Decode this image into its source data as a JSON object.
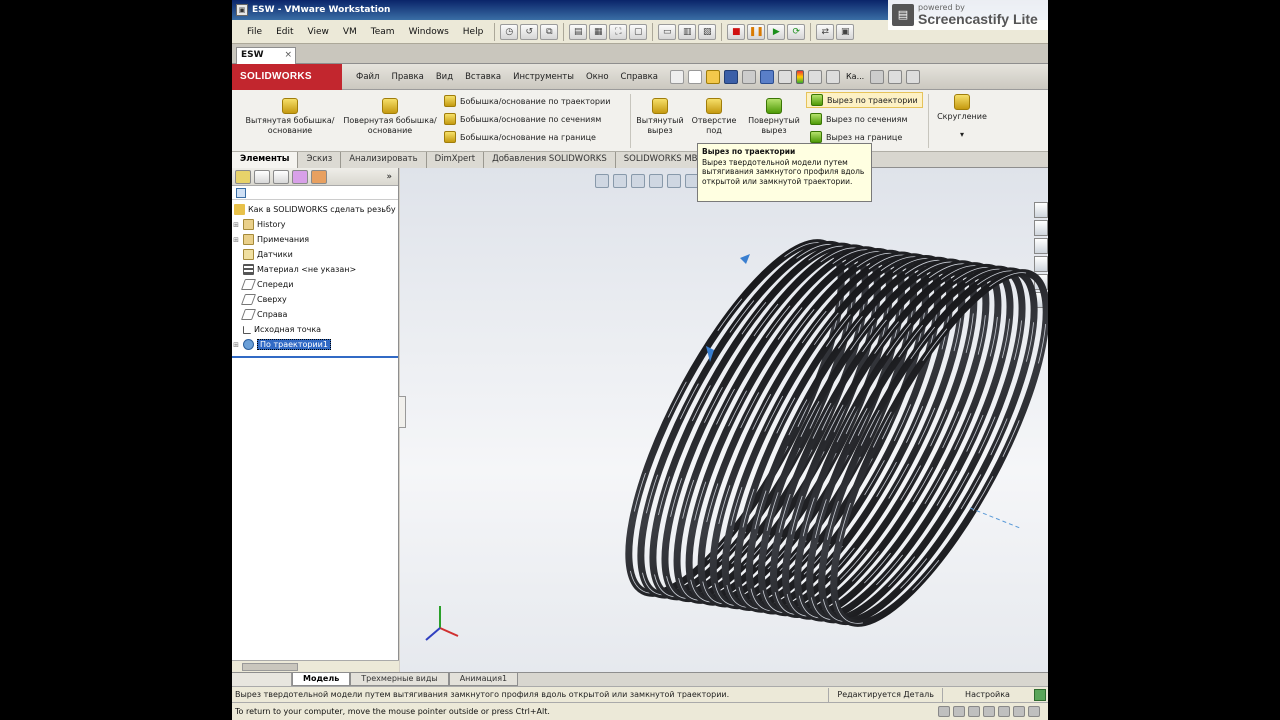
{
  "vm": {
    "window_title": "ESW - VMware Workstation",
    "menu": [
      "File",
      "Edit",
      "View",
      "VM",
      "Team",
      "Windows",
      "Help"
    ],
    "tab_label": "ESW",
    "tab_close": "×",
    "hint": "To return to your computer, move the mouse pointer outside or press Ctrl+Alt."
  },
  "watermark": {
    "small": "powered by",
    "big": "Screencastify Lite"
  },
  "solidworks": {
    "logo": "SOLIDWORKS",
    "menu": [
      "Файл",
      "Правка",
      "Вид",
      "Вставка",
      "Инструменты",
      "Окно",
      "Справка"
    ],
    "search_short": "Ка..."
  },
  "ribbon": {
    "extruded_boss": "Вытянутая бобышка/основание",
    "revolved_boss": "Повернутая бобышка/основание",
    "swept_boss": "Бобышка/основание по траектории",
    "lofted_boss": "Бобышка/основание по сечениям",
    "boundary_boss": "Бобышка/основание на границе",
    "extruded_cut": "Вытянутый вырез",
    "hole_wizard": "Отверстие под",
    "revolved_cut": "Повернутый вырез",
    "swept_cut": "Вырез по траектории",
    "lofted_cut": "Вырез по сечениям",
    "boundary_cut": "Вырез на границе",
    "fillet": "Скругление"
  },
  "cm_tabs": [
    "Элементы",
    "Эскиз",
    "Анализировать",
    "DimXpert",
    "Добавления SOLIDWORKS",
    "SOLIDWORKS MBD"
  ],
  "tooltip": {
    "title": "Вырез по траектории",
    "body": "Вырез твердотельной модели путем вытягивания замкнутого профиля вдоль открытой или замкнутой траектории."
  },
  "tree": {
    "root": "Как в SOLIDWORKS сделать резьбу",
    "items": [
      {
        "label": "History",
        "expandable": true
      },
      {
        "label": "Примечания",
        "expandable": true
      },
      {
        "label": "Датчики",
        "expandable": false
      },
      {
        "label": "Материал <не указан>",
        "expandable": false
      },
      {
        "label": "Спереди",
        "expandable": false
      },
      {
        "label": "Сверху",
        "expandable": false
      },
      {
        "label": "Справа",
        "expandable": false
      },
      {
        "label": "Исходная точка",
        "expandable": false
      },
      {
        "label": "По траектории1",
        "expandable": true,
        "selected": true
      }
    ]
  },
  "model_tabs": [
    "Модель",
    "Трехмерные виды",
    "Анимация1"
  ],
  "status": {
    "message": "Вырез твердотельной модели путем вытягивания замкнутого профиля вдоль открытой или замкнутой траектории.",
    "editing": "Редактируется Деталь",
    "settings": "Настройка"
  },
  "colors": {
    "vm_title": "#0a246a",
    "sw_red": "#c2262e",
    "selection": "#316ac5",
    "tooltip_bg": "#ffffe1"
  }
}
